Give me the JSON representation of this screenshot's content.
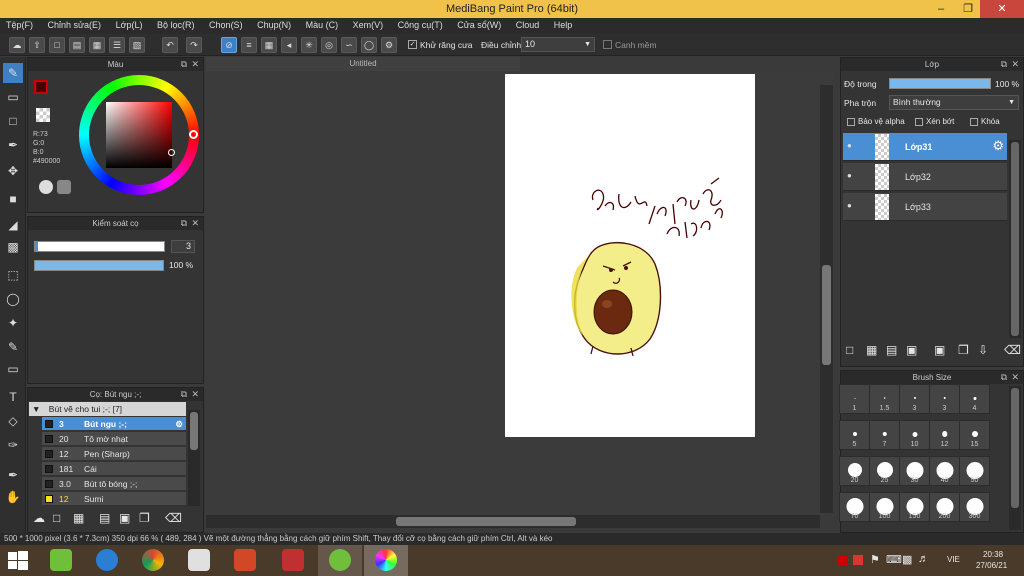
{
  "window": {
    "title": "MediBang Paint Pro (64bit)"
  },
  "menu": [
    "Tệp(F)",
    "Chỉnh sửa(E)",
    "Lớp(L)",
    "Bộ lọc(R)",
    "Chọn(S)",
    "Chụp(N)",
    "Màu (C)",
    "Xem(V)",
    "Công cụ(T)",
    "Cửa sổ(W)",
    "Cloud",
    "Help"
  ],
  "toolbar": {
    "antialias_label": "Khử răng cưa",
    "adjust_label": "Điều chỉnh",
    "adjust_value": "10",
    "smooth_label": "Canh mềm"
  },
  "color_panel": {
    "title": "Màu",
    "r": "R:73",
    "g": "G:0",
    "b": "B:0",
    "hex": "#490000",
    "fg_color": "#490000"
  },
  "brush_control": {
    "title": "Kiểm soát cọ",
    "size": "3",
    "opacity": "100 %"
  },
  "brush_panel": {
    "title": "Cọ: Bút ngu ;-;",
    "group": "Bút vẽ cho tui ;-; [7]",
    "items": [
      {
        "size": "3",
        "name": "Bút ngu ;-;",
        "selected": true
      },
      {
        "size": "20",
        "name": "Tô mờ nhạt"
      },
      {
        "size": "12",
        "name": "Pen (Sharp)"
      },
      {
        "size": "181",
        "name": "Cái"
      },
      {
        "size": "3.0",
        "name": "Bút tô bóng ;-;"
      },
      {
        "size": "12",
        "name": "Sumi"
      }
    ]
  },
  "canvas": {
    "tab_title": "Untitled"
  },
  "layer_panel": {
    "title": "Lớp",
    "opacity_label": "Độ trong",
    "opacity_value": "100 %",
    "blend_label": "Pha trộn",
    "blend_value": "Bình thường",
    "protect_alpha": "Bảo vệ alpha",
    "clipping": "Xén bớt",
    "lock": "Khóa",
    "layers": [
      "Lớp31",
      "Lớp32",
      "Lớp33"
    ]
  },
  "brush_size_panel": {
    "title": "Brush Size",
    "sizes": [
      "1",
      "1.5",
      "3",
      "3",
      "4",
      "5",
      "7",
      "10",
      "12",
      "15",
      "20",
      "25",
      "30",
      "40",
      "50",
      "70",
      "100",
      "150",
      "200",
      "300"
    ]
  },
  "status": {
    "text": "500 * 1000 pixel   (3.6 * 7.3cm)   350 dpi   66 %   ( 489, 284 )   Vẽ một đường thẳng bằng cách giữ phím Shift, Thay đổi cỡ cọ bằng cách giữ phím Ctrl, Alt và kéo"
  },
  "taskbar": {
    "lang": "VIE",
    "time": "20:38",
    "date": "27/06/21"
  }
}
